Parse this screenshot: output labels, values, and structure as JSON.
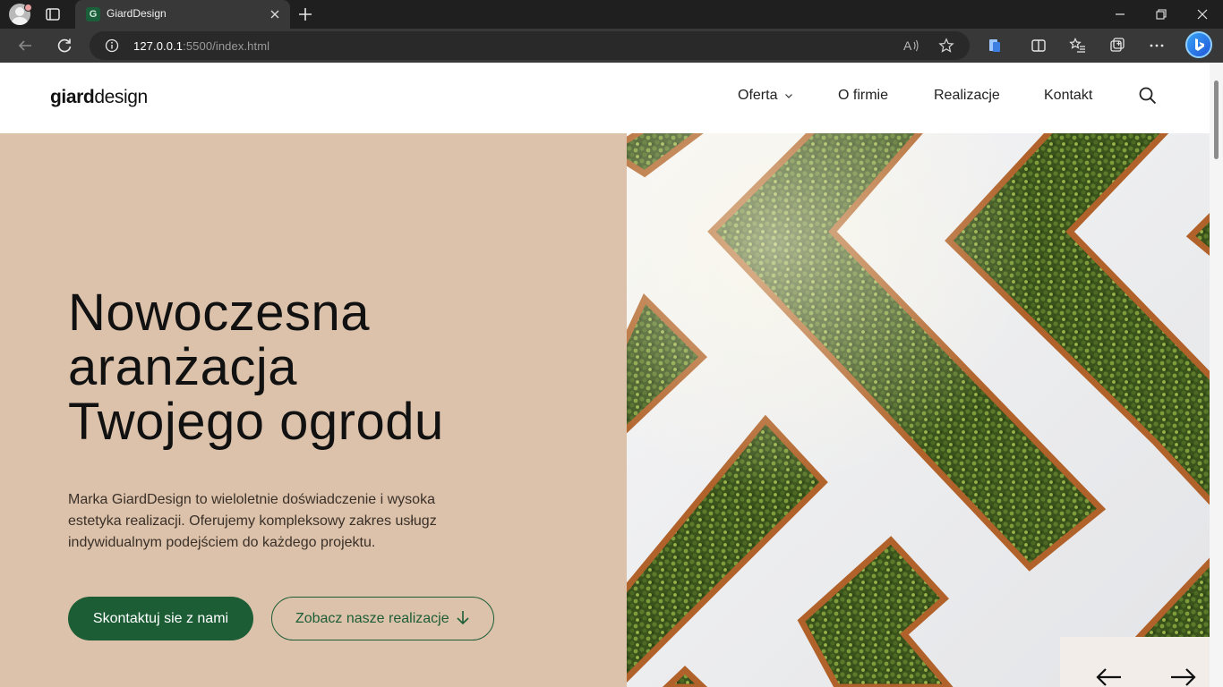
{
  "browser": {
    "tab_title": "GiardDesign",
    "favicon_letter": "G",
    "url_host": "127.0.0.1",
    "url_path": ":5500/index.html"
  },
  "site": {
    "logo_bold": "giard",
    "logo_regular": "design",
    "nav": [
      "Oferta",
      "O firmie",
      "Realizacje",
      "Kontakt"
    ]
  },
  "hero": {
    "title_lines": [
      "Nowoczesna",
      "aranżacja",
      "Twojego ogrodu"
    ],
    "text": "Marka GiardDesign to wieloletnie doświadczenie i wysoka estetyka realizacji. Oferujemy kompleksowy zakres usługz indywidualnym podejściem do każdego projektu.",
    "primary_button": "Skontaktuj sie z nami",
    "secondary_button": "Zobacz nasze realizacje"
  },
  "colors": {
    "hero_bg": "#dcc2ab",
    "brand_green": "#1c5d36",
    "hedge_green": "#3f5a1f",
    "planter_wood": "#b0622a",
    "wall": "#eeeef0"
  },
  "icons": {
    "search": "search-icon",
    "prev": "arrow-left-icon",
    "next": "arrow-right-icon"
  }
}
